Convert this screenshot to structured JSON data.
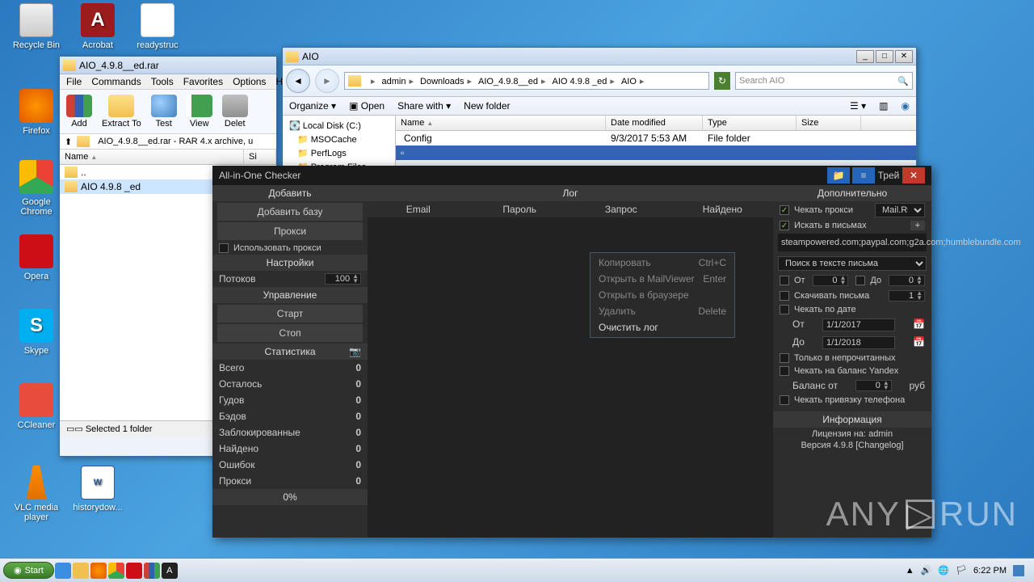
{
  "desktop": {
    "icons": [
      {
        "label": "Recycle Bin"
      },
      {
        "label": "Acrobat"
      },
      {
        "label": "readystruc"
      },
      {
        "label": "Firefox"
      },
      {
        "label": "Google Chrome"
      },
      {
        "label": "Opera"
      },
      {
        "label": "Skype"
      },
      {
        "label": "CCleaner"
      },
      {
        "label": "VLC media player"
      },
      {
        "label": "historydow..."
      }
    ]
  },
  "winrar": {
    "title": "AIO_4.9.8__ed.rar",
    "menu": [
      "File",
      "Commands",
      "Tools",
      "Favorites",
      "Options",
      "Help"
    ],
    "buttons": [
      "Add",
      "Extract To",
      "Test",
      "View",
      "Delet"
    ],
    "path": "AIO_4.9.8__ed.rar - RAR 4.x archive, u",
    "cols": [
      "Name",
      "Si"
    ],
    "rows": [
      "..",
      "AIO 4.9.8 _ed"
    ],
    "status": "Selected 1 folder"
  },
  "explorer": {
    "title": "AIO",
    "crumbs": [
      "",
      "admin",
      "Downloads",
      "AIO_4.9.8__ed",
      "AIO 4.9.8 _ed",
      "AIO"
    ],
    "search": "Search AIO",
    "toolbar_organize": "Organize",
    "toolbar_open": "Open",
    "toolbar_share": "Share with",
    "toolbar_new": "New folder",
    "tree": [
      "Local Disk (C:)",
      "MSOCache",
      "PerfLogs",
      "Program Files"
    ],
    "cols": [
      "Name",
      "Date modified",
      "Type",
      "Size"
    ],
    "files": [
      {
        "name": "Config",
        "date": "9/3/2017 5:53 AM",
        "type": "File folder",
        "size": ""
      }
    ]
  },
  "aio": {
    "title": "All-in-One Checker",
    "tray_label": "Трей",
    "left": {
      "hdr_add": "Добавить",
      "btn_addbase": "Добавить базу",
      "btn_proxy": "Прокси",
      "use_proxy": "Использовать прокси",
      "hdr_settings": "Настройки",
      "threads_lbl": "Потоков",
      "threads_val": "100",
      "hdr_control": "Управление",
      "btn_start": "Старт",
      "btn_stop": "Стоп",
      "hdr_stats": "Статистика",
      "stats": [
        [
          "Всего",
          "0"
        ],
        [
          "Осталось",
          "0"
        ],
        [
          "Гудов",
          "0"
        ],
        [
          "Бэдов",
          "0"
        ],
        [
          "Заблокированные",
          "0"
        ],
        [
          "Найдено",
          "0"
        ],
        [
          "Ошибок",
          "0"
        ],
        [
          "Прокси",
          "0"
        ]
      ],
      "progress": "0%"
    },
    "mid": {
      "hdr": "Лог",
      "cols": [
        "Email",
        "Пароль",
        "Запрос",
        "Найдено"
      ],
      "ctx": [
        [
          "Копировать",
          "Ctrl+C",
          false
        ],
        [
          "Открыть в MailViewer",
          "Enter",
          false
        ],
        [
          "Открыть в браузере",
          "",
          false
        ],
        [
          "Удалить",
          "Delete",
          false
        ],
        [
          "Очистить лог",
          "",
          true
        ]
      ]
    },
    "right": {
      "hdr": "Дополнительно",
      "check_proxy": "Чекать прокси",
      "proxy_provider": "Mail.Ru",
      "search_mail": "Искать в письмах",
      "plus": "+",
      "domains": "steampowered.com;paypal.com;g2a.com;humblebundle.com",
      "search_text": "Поиск в тексте письма",
      "from_lbl": "От",
      "from_val": "0",
      "to_lbl": "До",
      "to_val": "0",
      "download_mail": "Скачивать письма",
      "download_val": "1",
      "check_date": "Чекать по дате",
      "date_from_lbl": "От",
      "date_from": "1/1/2017",
      "date_to_lbl": "До",
      "date_to": "1/1/2018",
      "only_unread": "Только в непрочитанных",
      "check_yandex": "Чекать на баланс Yandex",
      "balance_lbl": "Баланс от",
      "balance_val": "0",
      "balance_cur": "руб",
      "check_phone": "Чекать привязку телефона",
      "hdr_info": "Информация",
      "license": "Лицензия на: admin",
      "version": "Версия 4.9.8 [Changelog]"
    }
  },
  "taskbar": {
    "start": "Start",
    "time": "6:22 PM"
  },
  "watermark": {
    "a": "ANY",
    "b": "RUN"
  }
}
